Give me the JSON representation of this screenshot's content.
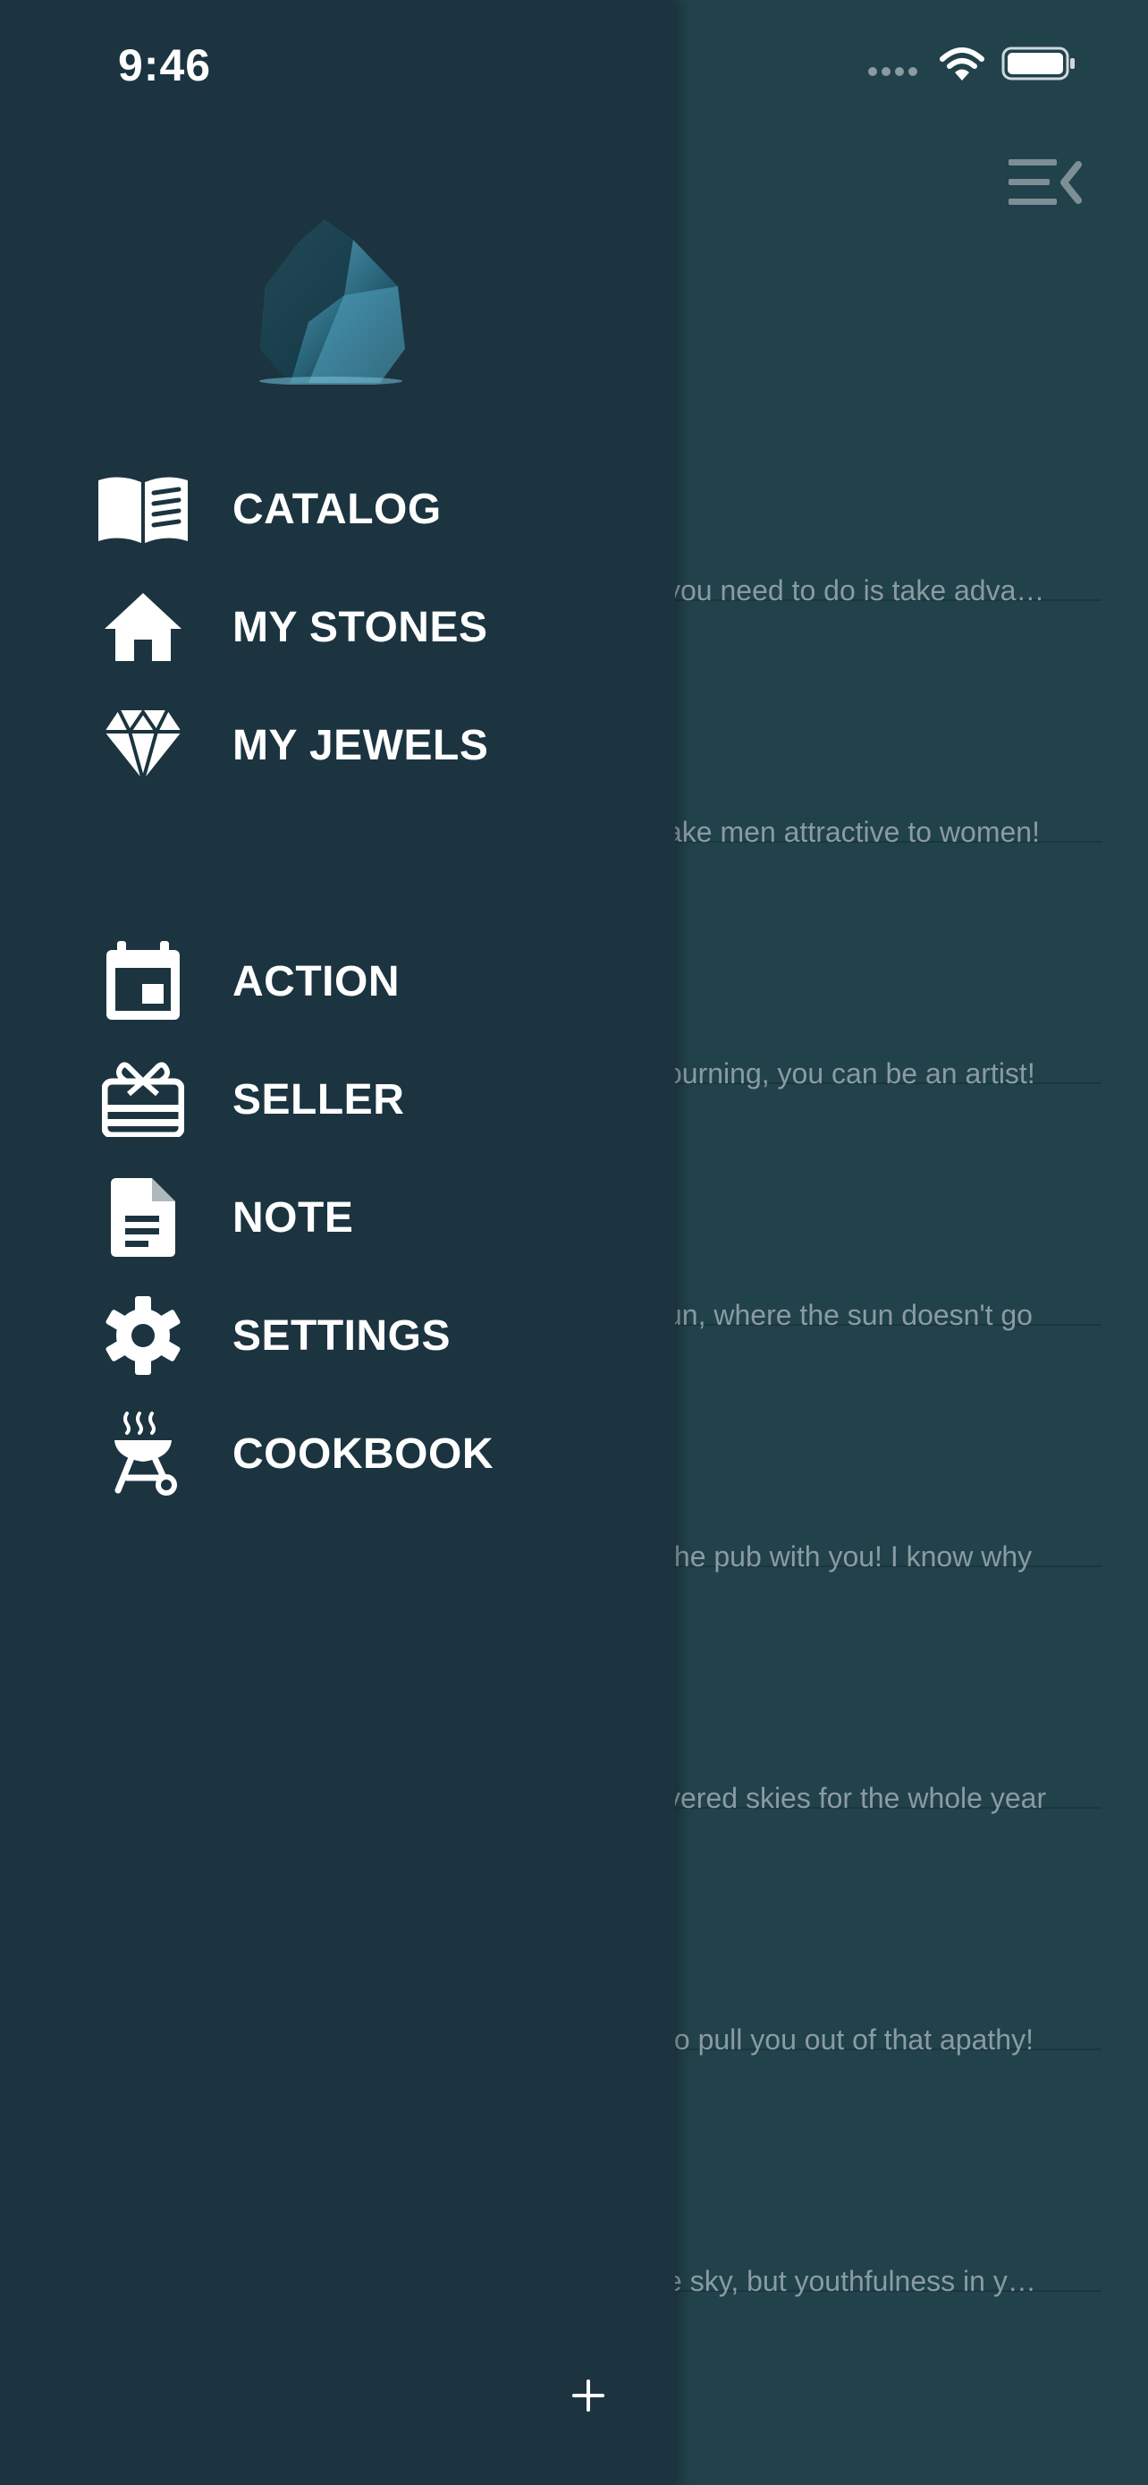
{
  "status_bar": {
    "time": "9:46"
  },
  "menu": {
    "primary": [
      {
        "label": "CATALOG",
        "icon": "book-open-icon"
      },
      {
        "label": "MY STONES",
        "icon": "home-icon"
      },
      {
        "label": "MY JEWELS",
        "icon": "diamond-icon"
      }
    ],
    "secondary": [
      {
        "label": "ACTION",
        "icon": "calendar-icon"
      },
      {
        "label": "SELLER",
        "icon": "gift-card-icon"
      },
      {
        "label": "NOTE",
        "icon": "document-icon"
      },
      {
        "label": "SETTINGS",
        "icon": "gear-icon"
      },
      {
        "label": "COOKBOOK",
        "icon": "grill-icon"
      }
    ],
    "add_icon": "plus-icon"
  },
  "feed": {
    "items": [
      "you need to do is take adva…",
      "ake men attractive to women!",
      "ourning, you can be an artist!",
      "un, where the sun doesn't go",
      " the pub with you! I know why",
      "vered skies for the whole year",
      "to pull you out of that apathy!",
      "e sky, but youthfulness in y…"
    ]
  },
  "colors": {
    "background": "#21414b",
    "drawer": "#1b3440",
    "text": "#ffffff",
    "snippet": "#8a9ba1"
  }
}
